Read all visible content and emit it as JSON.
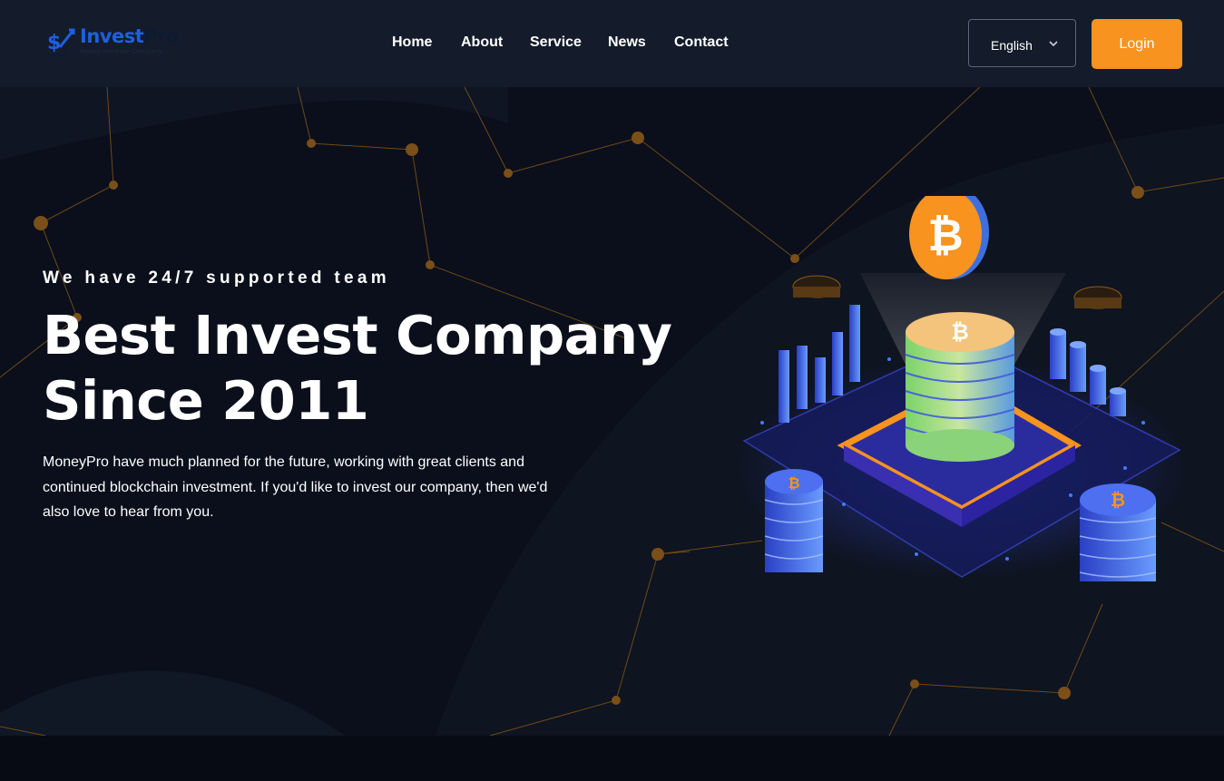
{
  "header": {
    "logo": {
      "brand_primary": "Invest",
      "brand_secondary": "Pro",
      "tagline": "Money Increase Company"
    },
    "nav": [
      {
        "label": "Home"
      },
      {
        "label": "About"
      },
      {
        "label": "Service"
      },
      {
        "label": "News"
      },
      {
        "label": "Contact"
      }
    ],
    "language": {
      "selected": "English"
    },
    "login_label": "Login"
  },
  "hero": {
    "eyebrow": "We have 24/7 supported team",
    "headline_line1": "Best Invest Company",
    "headline_line2": "Since 2011",
    "description": "MoneyPro have much planned for the future, working with great clients and continued blockchain investment. If you'd like to invest our company, then we'd also love to hear from you."
  },
  "colors": {
    "accent": "#f7931e",
    "header_bg": "#141c2b",
    "hero_bg": "#0a0f1b",
    "network_line": "#8a5a1c",
    "brand_blue": "#1f5fe0"
  },
  "icons": [
    "logo-mark-icon",
    "chevron-down-icon",
    "crypto-coin-icon",
    "crypto-illustration"
  ]
}
